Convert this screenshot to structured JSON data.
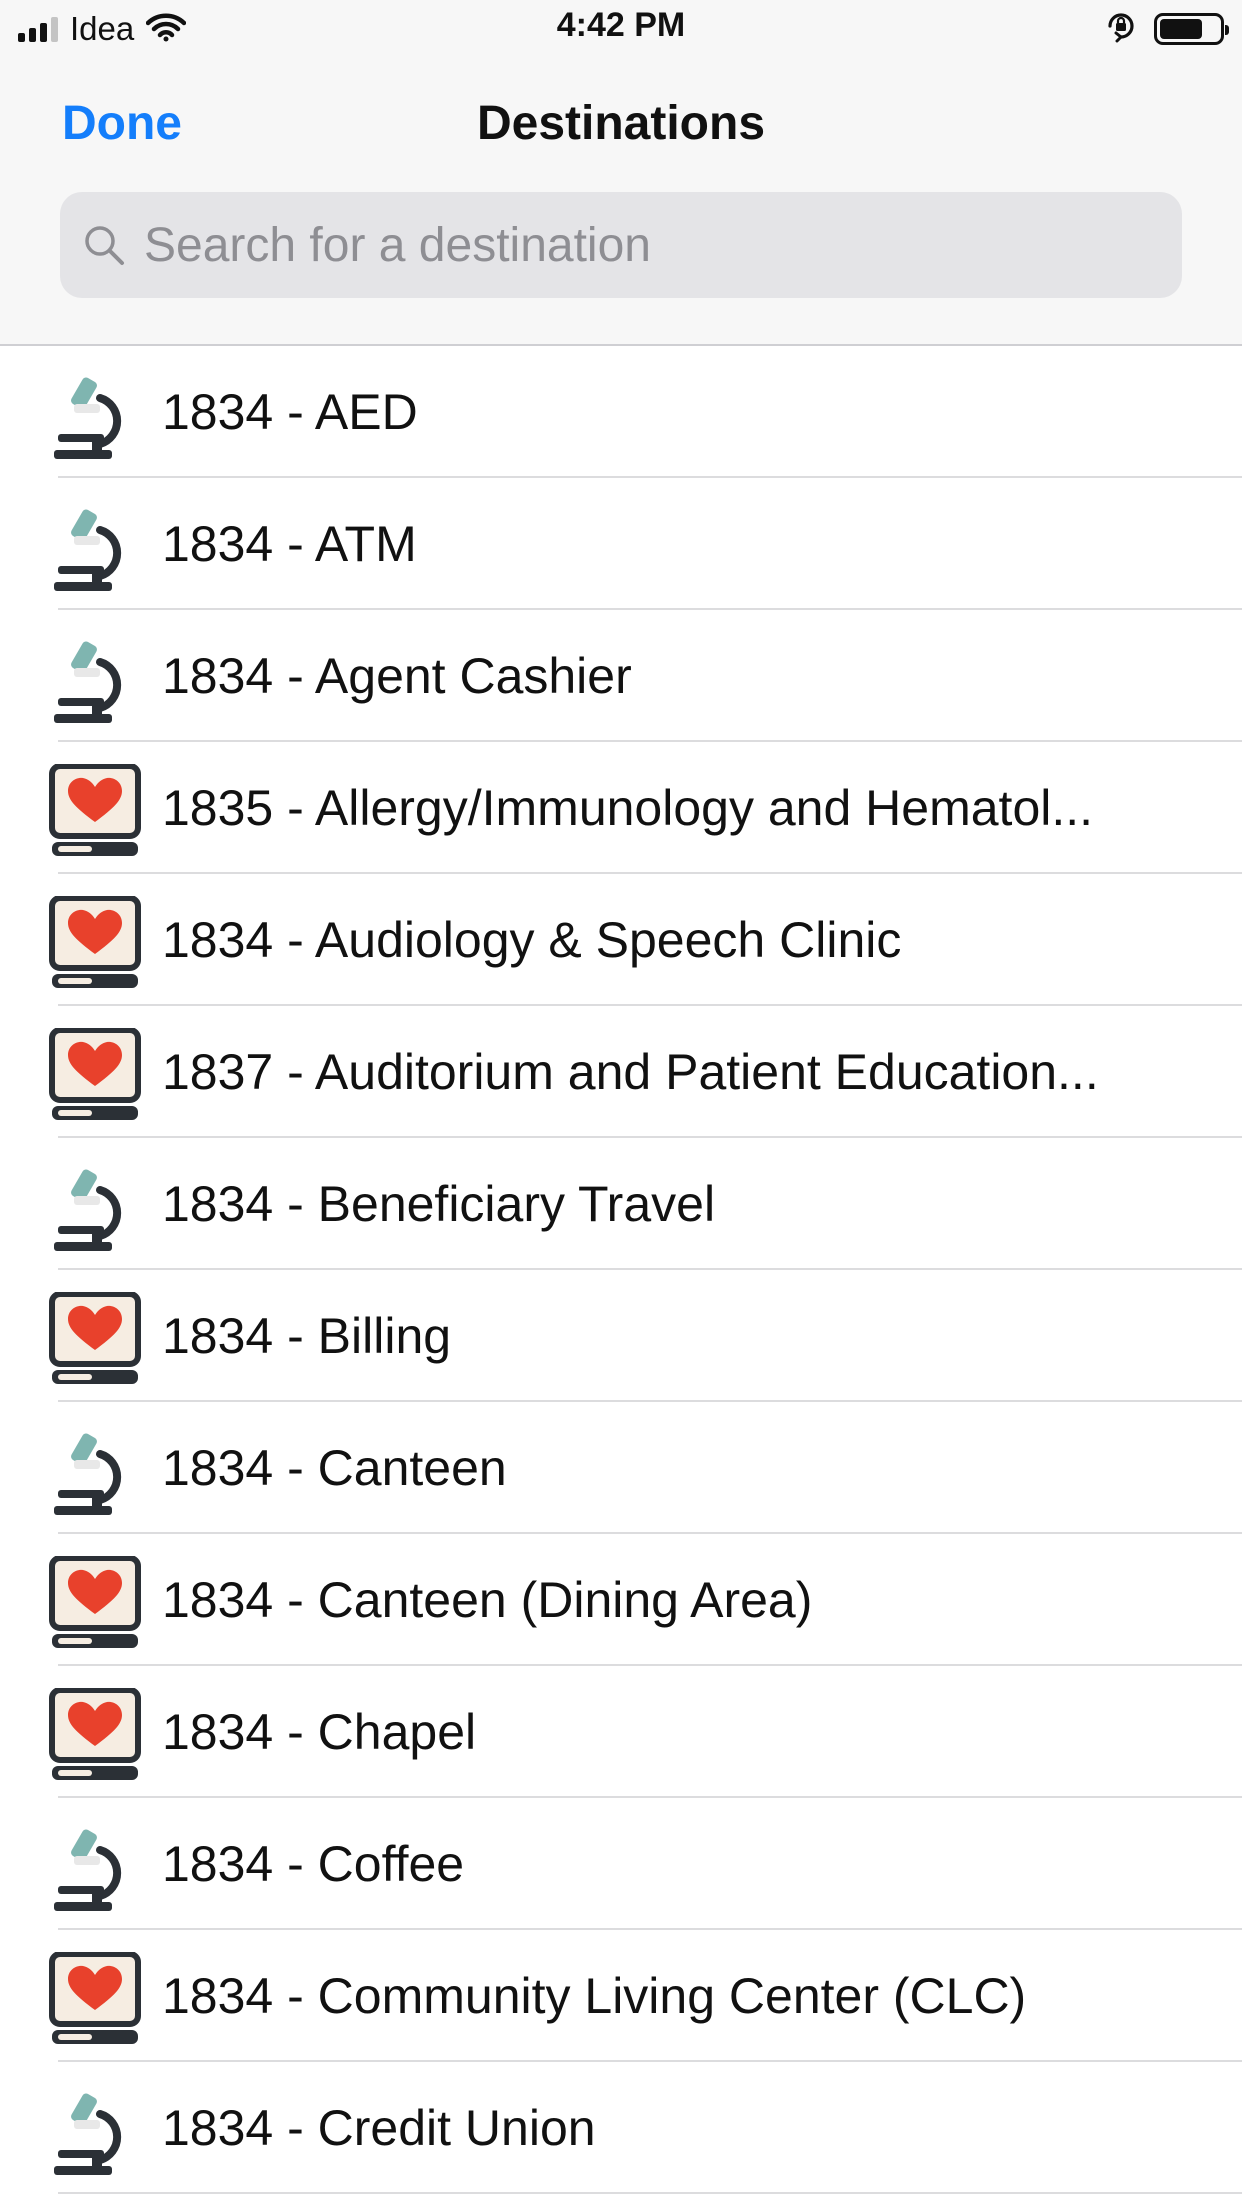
{
  "status_bar": {
    "carrier": "Idea",
    "time": "4:42 PM",
    "battery_level": 0.72
  },
  "header": {
    "done_label": "Done",
    "title": "Destinations"
  },
  "search": {
    "placeholder": "Search for a destination",
    "value": ""
  },
  "colors": {
    "accent": "#147efb",
    "microscope_lens": "#7fb5b0",
    "heart": "#e8412c"
  },
  "destinations": [
    {
      "label": "1834 - AED",
      "icon": "microscope-icon"
    },
    {
      "label": "1834 - ATM",
      "icon": "microscope-icon"
    },
    {
      "label": "1834 - Agent Cashier",
      "icon": "microscope-icon"
    },
    {
      "label": "1835 - Allergy/Immunology and Hematol...",
      "icon": "heart-monitor-icon"
    },
    {
      "label": "1834 - Audiology & Speech Clinic",
      "icon": "heart-monitor-icon"
    },
    {
      "label": "1837 - Auditorium and Patient Education...",
      "icon": "heart-monitor-icon"
    },
    {
      "label": "1834 - Beneficiary Travel",
      "icon": "microscope-icon"
    },
    {
      "label": "1834 - Billing",
      "icon": "heart-monitor-icon"
    },
    {
      "label": "1834 - Canteen",
      "icon": "microscope-icon"
    },
    {
      "label": "1834 - Canteen (Dining Area)",
      "icon": "heart-monitor-icon"
    },
    {
      "label": "1834 - Chapel",
      "icon": "heart-monitor-icon"
    },
    {
      "label": "1834 - Coffee",
      "icon": "microscope-icon"
    },
    {
      "label": "1834 - Community Living Center (CLC)",
      "icon": "heart-monitor-icon"
    },
    {
      "label": "1834 - Credit Union",
      "icon": "microscope-icon"
    }
  ]
}
